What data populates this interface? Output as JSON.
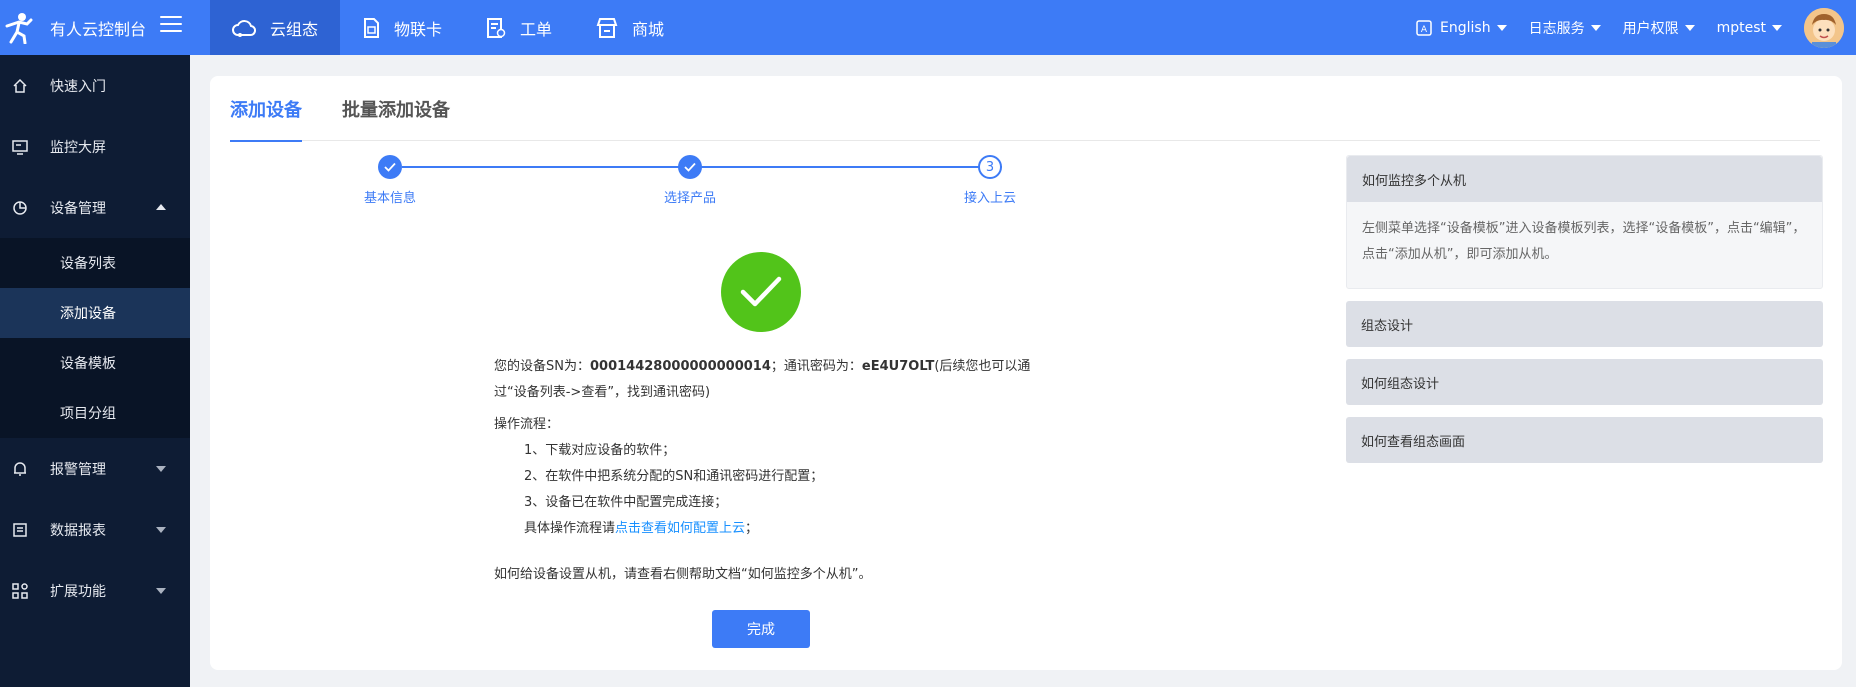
{
  "brand": {
    "title": "有人云控制台"
  },
  "topnav": [
    {
      "label": "云组态",
      "icon": "cloud-icon"
    },
    {
      "label": "物联卡",
      "icon": "sim-card-icon"
    },
    {
      "label": "工单",
      "icon": "work-order-icon"
    },
    {
      "label": "商城",
      "icon": "store-icon"
    }
  ],
  "topright": {
    "language": "English",
    "log": "日志服务",
    "permission": "用户权限",
    "user": "mptest"
  },
  "sidebar": {
    "items": [
      {
        "label": "快速入门",
        "icon": "home-icon"
      },
      {
        "label": "监控大屏",
        "icon": "monitor-icon"
      },
      {
        "label": "设备管理",
        "icon": "device-icon"
      },
      {
        "label": "报警管理",
        "icon": "bell-icon"
      },
      {
        "label": "数据报表",
        "icon": "report-icon"
      },
      {
        "label": "扩展功能",
        "icon": "apps-icon"
      }
    ],
    "sub": [
      "设备列表",
      "添加设备",
      "设备模板",
      "项目分组"
    ]
  },
  "tabs": [
    "添加设备",
    "批量添加设备"
  ],
  "steps": [
    "基本信息",
    "选择产品",
    "接入上云"
  ],
  "step3_number": "3",
  "info": {
    "sn_prefix": "您的设备SN为：",
    "sn": "00014428000000000014",
    "pwd_prefix": "；通讯密码为：",
    "pwd": "eE4U7OLT",
    "pwd_suffix": "(后续您也可以通过“设备列表->查看”，找到通讯密码)",
    "process_title": "操作流程：",
    "step1": "1、下载对应设备的软件；",
    "step2": "2、在软件中把系统分配的SN和通讯密码进行配置；",
    "step3": "3、设备已在软件中配置完成连接；",
    "detail_prefix": "具体操作流程请",
    "detail_link": "点击查看如何配置上云",
    "detail_suffix": "；",
    "slave_tip": "如何给设备设置从机，请查看右侧帮助文档“如何监控多个从机”。"
  },
  "done_button": "完成",
  "help": {
    "first_title": "如何监控多个从机",
    "first_body": "左侧菜单选择“设备模板”进入设备模板列表，选择“设备模板”，点击“编辑”，点击“添加从机”，即可添加从机。",
    "items": [
      "组态设计",
      "如何组态设计",
      "如何查看组态画面"
    ]
  },
  "colors": {
    "primary": "#3d7bf6",
    "sidebar": "#0e1c34",
    "success": "#52c41a"
  }
}
